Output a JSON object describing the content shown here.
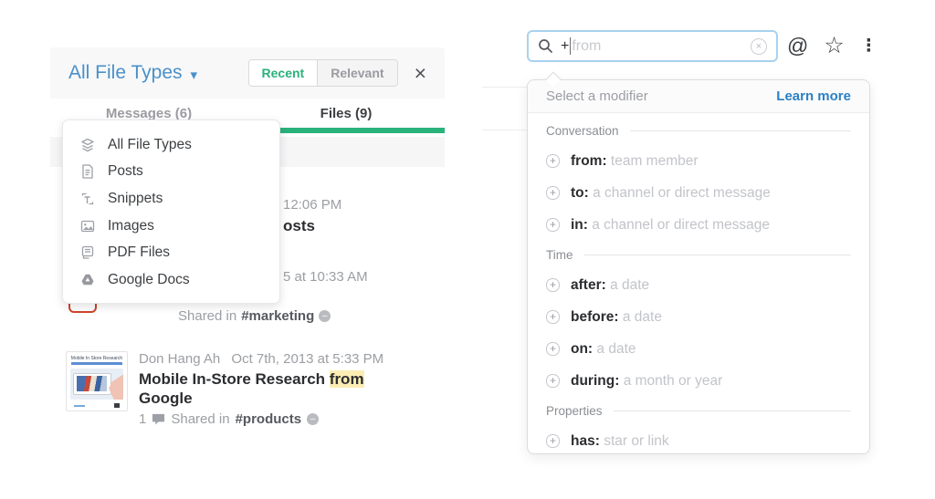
{
  "left_panel": {
    "title": "All File Types",
    "sort_recent": "Recent",
    "sort_relevant": "Relevant",
    "tabs": {
      "messages": "Messages (6)",
      "files": "Files (9)"
    },
    "file_type_menu": {
      "items": [
        {
          "icon": "layers-icon",
          "label": "All File Types"
        },
        {
          "icon": "post-icon",
          "label": "Posts"
        },
        {
          "icon": "snippet-icon",
          "label": "Snippets"
        },
        {
          "icon": "image-icon",
          "label": "Images"
        },
        {
          "icon": "pdf-icon",
          "label": "PDF Files"
        },
        {
          "icon": "google-drive-icon",
          "label": "Google Docs"
        }
      ]
    },
    "obscured_results": {
      "row1_time_fragment": "12:06 PM",
      "row1_title_fragment": "osts",
      "row2_time_fragment": "5 at 10:33 AM",
      "row2_shared_prefix": "Shared in",
      "row2_channel": "#marketing"
    },
    "result": {
      "author": "Don Hang Ah",
      "timestamp": "Oct 7th, 2013 at 5:33 PM",
      "title_pre": "Mobile In-Store Research ",
      "title_highlight": "from",
      "title_post": " Google",
      "comment_count": "1",
      "shared_prefix": "Shared in",
      "channel": "#products",
      "thumbnail_caption": "Mobile In Store Research"
    }
  },
  "search": {
    "typed": "+",
    "placeholder_remainder": "from"
  },
  "icons": {
    "caret_down": "▾",
    "close": "×",
    "at": "@",
    "star": "☆",
    "overflow": "⋮",
    "clear": "×",
    "plus": "+"
  },
  "modifier_panel": {
    "header": "Select a modifier",
    "learn_more": "Learn more",
    "sections": [
      {
        "label": "Conversation",
        "items": [
          {
            "keyword": "from:",
            "description": "team member"
          },
          {
            "keyword": "to:",
            "description": "a channel or direct message"
          },
          {
            "keyword": "in:",
            "description": "a channel or direct message"
          }
        ]
      },
      {
        "label": "Time",
        "items": [
          {
            "keyword": "after:",
            "description": "a date"
          },
          {
            "keyword": "before:",
            "description": "a date"
          },
          {
            "keyword": "on:",
            "description": "a date"
          },
          {
            "keyword": "during:",
            "description": "a month or year"
          }
        ]
      },
      {
        "label": "Properties",
        "items": [
          {
            "keyword": "has:",
            "description": "star or link"
          }
        ]
      }
    ]
  },
  "colors": {
    "accent_green": "#2ab27b",
    "accent_blue": "#4a90ca",
    "link_blue": "#2b80c4",
    "highlight_yellow": "#fbedb4",
    "pdf_red": "#d0442c"
  }
}
